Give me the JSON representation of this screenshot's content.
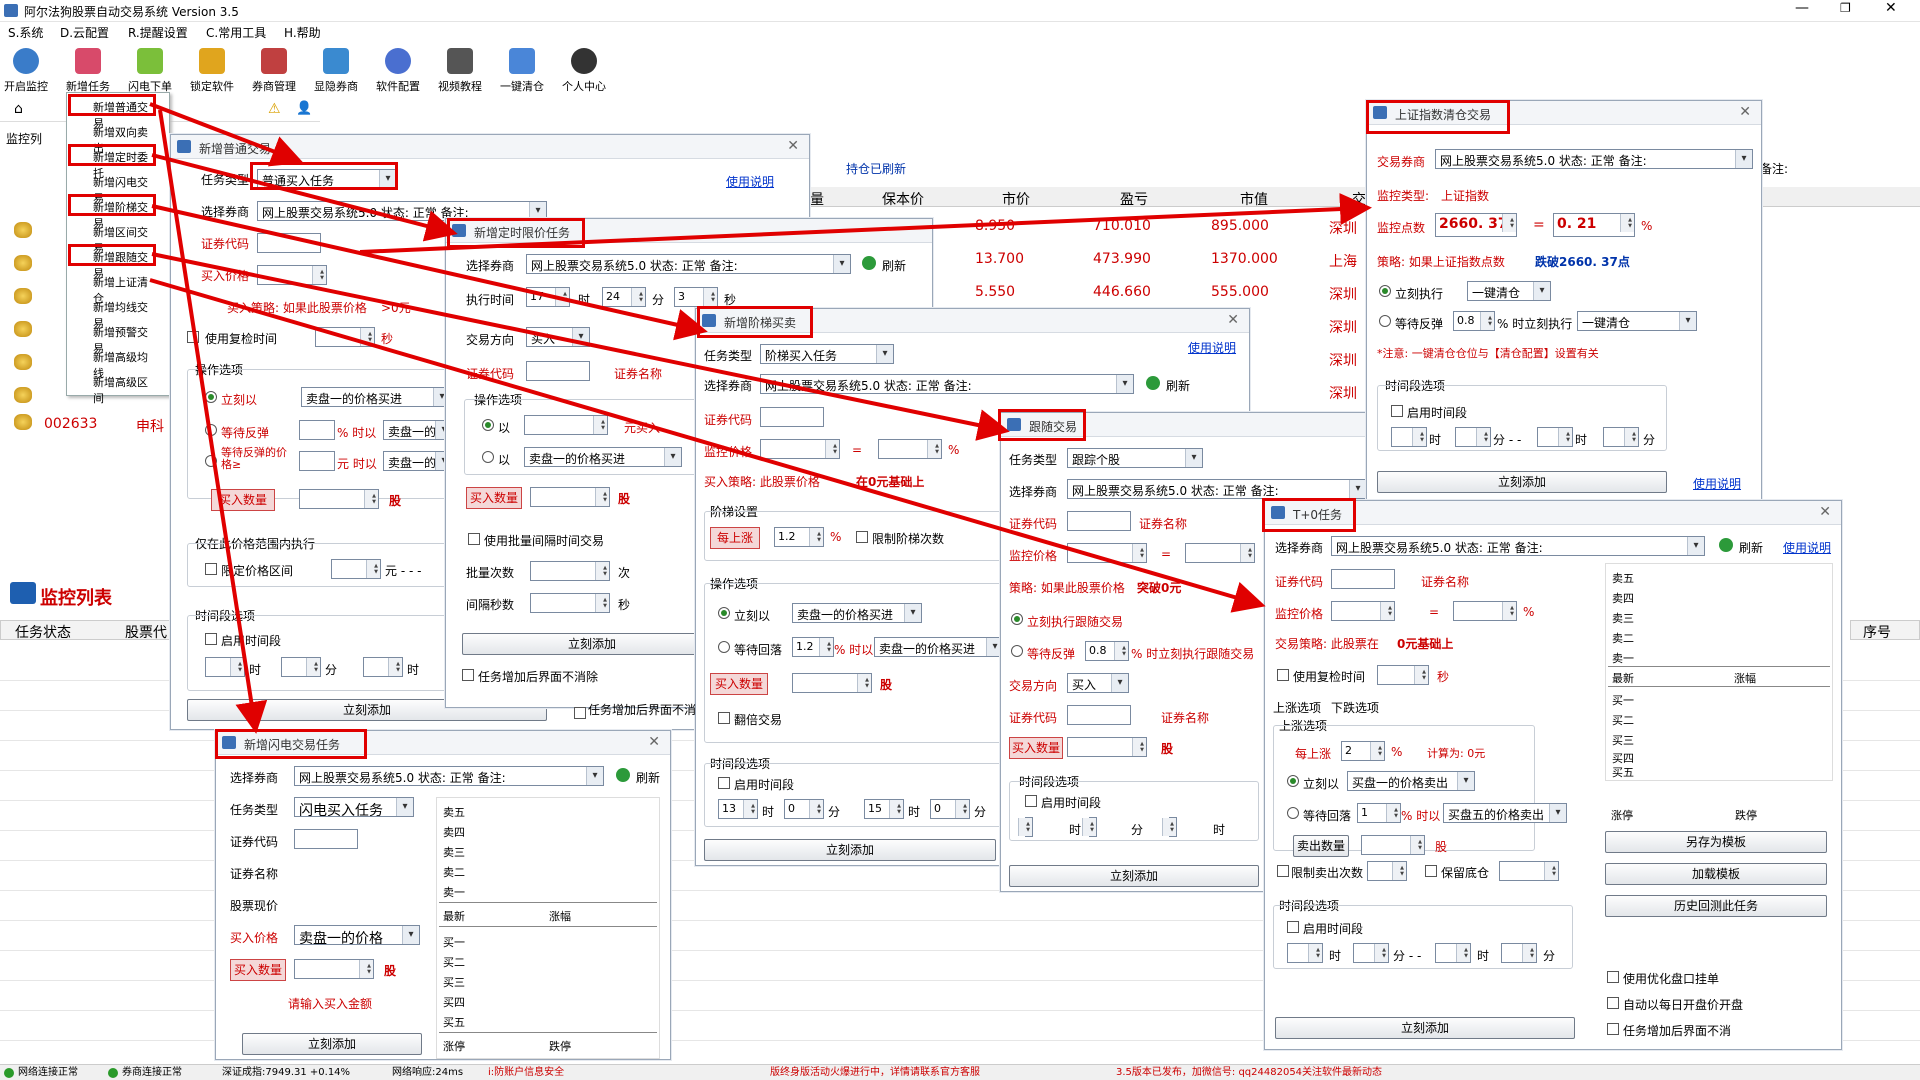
{
  "app": {
    "title": "阿尔法狗股票自动交易系统 Version 3.5"
  },
  "menu": [
    "S.系统",
    "D.云配置",
    "R.提醒设置",
    "C.常用工具",
    "H.帮助"
  ],
  "toolbar": [
    "开启监控",
    "新增任务",
    "闪电下单",
    "锁定软件",
    "券商管理",
    "显隐券商",
    "软件配置",
    "视频教程",
    "一键清仓",
    "个人中心"
  ],
  "dropdown": [
    "新增普通交易",
    "新增双向卖出",
    "新增定时委托",
    "新增闪电交易",
    "新增阶梯交易",
    "新增区间交易",
    "新增跟随交易",
    "新增上证清仓",
    "新增均线交易",
    "新增预警交易",
    "新增高级均线",
    "新增高级区间"
  ],
  "bg": {
    "monitor_label": "监控列",
    "holding_refreshed": "持仓已刷新",
    "cols": [
      "量",
      "保本价",
      "市价",
      "盈亏",
      "市值",
      "交"
    ],
    "rows": [
      [
        "8.950",
        "710.010",
        "895.000",
        "深圳"
      ],
      [
        "13.700",
        "473.990",
        "1370.000",
        "上海"
      ],
      [
        "5.550",
        "446.660",
        "555.000",
        "深圳"
      ],
      [
        "",
        "",
        "",
        "深圳"
      ],
      [
        "",
        "",
        "",
        "深圳"
      ],
      [
        "",
        "",
        "",
        "深圳"
      ]
    ],
    "stock_code": "002633",
    "stock_name": "申科",
    "list_title": "监控列表",
    "list_cols": [
      "任务状态",
      "股票代"
    ],
    "seq": "序号",
    "remark": "备注:"
  },
  "common": {
    "broker": "网上股票交易系统5.0 状态: 正常 备注:",
    "refresh": "刷新",
    "help": "使用说明",
    "add_now": "立刻添加",
    "hour": "时",
    "min": "分",
    "sec": "秒",
    "stock_code": "证券代码",
    "stock_name": "证券名称",
    "buy_qty": "买入数量",
    "share": "股",
    "time_opts": "时间段选项",
    "enable_time": "启用时间段",
    "select_broker": "选择券商",
    "task_type": "任务类型",
    "ops": "操作选项",
    "monitor_price": "监控价格",
    "yuan": "元"
  },
  "w_normal": {
    "title": "新增普通交易",
    "task_type": "普通买入任务",
    "buy_price": "买入价格",
    "strategy": "买入策略: 如果此股票价格",
    "strategy_tail": ">0元",
    "use_recheck": "使用复检时间",
    "now": "立刻以",
    "sell1": "卖盘一的价格买进",
    "wait_rebound": "等待反弹",
    "pct_time": "% 时以",
    "sell1_short": "卖盘一的价",
    "wait_price": "等待反弹的价格≥",
    "yuan_time": "元 时以",
    "range_only": "仅在此价格范围内执行",
    "limit_range": "限定价格区间",
    "yuan_dash": "元 - - -"
  },
  "w_timed": {
    "title": "新增定时限价任务",
    "exec_time": "执行时间",
    "h": "17",
    "m": "24",
    "s": "3",
    "direction": "交易方向",
    "dir_val": "买入",
    "by": "以",
    "yuan_buy": "元买入",
    "by2": "以",
    "sell1": "卖盘一的价格买进",
    "batch": "使用批量间隔时间交易",
    "batch_n": "批量次数",
    "interval": "间隔秒数",
    "times": "次",
    "keep": "任务增加后界面不消除"
  },
  "w_ladder": {
    "title": "新增阶梯买卖",
    "task_type": "阶梯买入任务",
    "strategy": "买入策略: 此股票价格",
    "strategy_red": "在0元基础上",
    "ladder_set": "阶梯设置",
    "each_up": "每上涨",
    "up_val": "1.2",
    "limit_n": "限制阶梯次数",
    "now": "立刻以",
    "sell1": "卖盘一的价格买进",
    "wait_fall": "等待回落",
    "fall_val": "1.2",
    "pct_time": "% 时以",
    "sell1b": "卖盘一的价格买进",
    "flip": "翻倍交易",
    "h1": "13",
    "m1": "0",
    "h2": "15",
    "m2": "0",
    "keep": "任务增加后界面不消"
  },
  "w_follow": {
    "title": "跟随交易",
    "task_type": "跟踪个股",
    "strategy": "策略: 如果此股票价格",
    "strategy_red": "突破0元",
    "now": "立刻执行跟随交易",
    "wait": "等待反弹",
    "wait_val": "0.8",
    "wait_tail": "% 时立刻执行跟随交易",
    "direction": "交易方向",
    "dir_val": "买入"
  },
  "w_sh": {
    "title": "上证指数清仓交易",
    "broker_lbl": "交易券商",
    "mon_type_lbl": "监控类型:",
    "mon_type": "上证指数",
    "mon_points_lbl": "监控点数",
    "points": "2660. 37",
    "pct": "0. 21",
    "strategy": "策略: 如果上证指数点数",
    "strategy_blue": "跌破2660. 37点",
    "now": "立刻执行",
    "clear": "一键清仓",
    "wait": "等待反弹",
    "wait_val": "0.8",
    "wait_tail": "% 时立刻执行",
    "clear2": "一键清仓",
    "note": "*注意: 一键清仓仓位与【清仓配置】设置有关"
  },
  "w_t0": {
    "title": "T+0任务",
    "strategy": "交易策略: 此股票在",
    "strategy_red": "0元基础上",
    "tab_up": "上涨选项",
    "tab_down": "下跌选项",
    "grp_up": "上涨选项",
    "each_up": "每上涨",
    "up_val": "2",
    "calc": "计算为: 0元",
    "now": "立刻以",
    "buy1": "买盘一的价格卖出",
    "wait_fall": "等待回落",
    "fall_val": "1",
    "pct_time": "% 时以",
    "buy5": "买盘五的价格卖出",
    "sell_qty": "卖出数量",
    "limit_sell": "限制卖出次数",
    "keep_pos": "保留底仓",
    "book": [
      "卖五",
      "卖四",
      "卖三",
      "卖二",
      "卖一",
      "买一",
      "买二",
      "买三",
      "买四",
      "买五"
    ],
    "latest": "最新",
    "change": "涨幅",
    "limit_up": "涨停",
    "limit_down": "跌停",
    "save_tpl": "另存为模板",
    "load_tpl": "加载模板",
    "history": "历史回测此任务",
    "opt_book": "使用优化盘口挂单",
    "auto_open": "自动以每日开盘价开盘",
    "keep": "任务增加后界面不消"
  },
  "w_flash": {
    "title": "新增闪电交易任务",
    "task_type": "闪电买入任务",
    "cur_price": "股票现价",
    "buy_price_lbl": "买入价格",
    "buy_price": "卖盘一的价格",
    "hint": "请输入买入金额",
    "book_sell": [
      "卖五",
      "卖四",
      "卖三",
      "卖二",
      "卖一"
    ],
    "book_buy": [
      "买一",
      "买二",
      "买三",
      "买四",
      "买五"
    ],
    "latest": "最新",
    "change": "涨幅",
    "limit_up": "涨停",
    "limit_down": "跌停"
  },
  "status": [
    "网络连接正常",
    "券商连接正常",
    "深证成指:7949.31 +0.14%",
    "网络响应:24ms",
    "i:防账户信息安全",
    "版终身版活动火爆进行中，详情请联系官方客服",
    "3.5版本已发布，加微信号: qq24482054关注软件最新动态"
  ]
}
